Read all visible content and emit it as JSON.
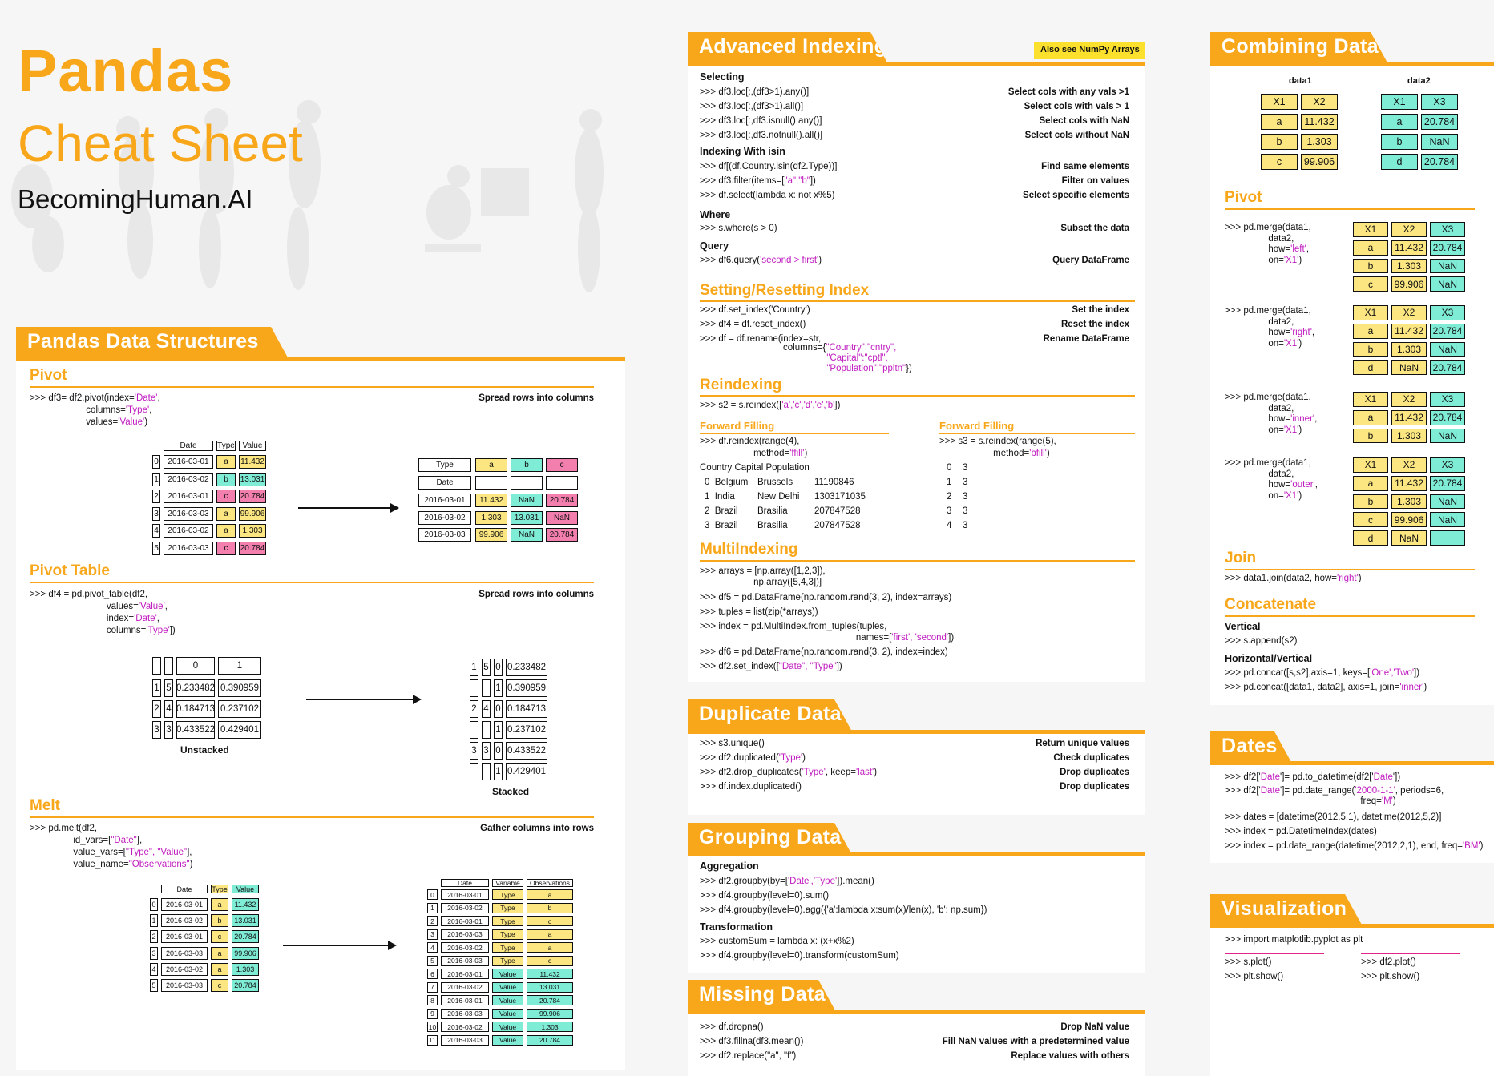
{
  "header": {
    "title": "Pandas",
    "subtitle": "Cheat Sheet",
    "brand": "BecomingHuman.AI"
  },
  "colors": {
    "accent": "#f9a71a",
    "yellow": "#fbe681",
    "teal": "#7fecd6",
    "pink": "#f27fad",
    "magenta": "#c01bbf"
  },
  "structures": {
    "title": "Pandas Data Structures",
    "pivot": {
      "title": "Pivot",
      "desc": "Spread rows into columns",
      "l1": ">>> df3= df2.pivot(index=",
      "l1m": "'Date'",
      "l1e": ",",
      "l2": "columns=",
      "l2m": "'Type'",
      "l2e": ",",
      "l3": "values=",
      "l3m": "'Value'",
      "l3e": ")"
    },
    "pivot_table": {
      "title": "Pivot Table",
      "desc": "Spread rows into columns",
      "l1": ">>> df4 = pd.pivot_table(df2,",
      "l2": "values=",
      "l2m": "'Value'",
      "l2e": ",",
      "l3": "index=",
      "l3m": "'Date'",
      "l3e": ",",
      "l4": "columns=",
      "l4m": "'Type'",
      "l4e": "])",
      "unstacked": "Unstacked",
      "stacked": "Stacked"
    },
    "melt": {
      "title": "Melt",
      "desc": "Gather columns into rows",
      "l1": ">>> pd.melt(df2,",
      "l2": "id_vars=[",
      "l2m": "\"Date\"",
      "l2e": "],",
      "l3": "value_vars=[",
      "l3m": "\"Type\", \"Value\"",
      "l3e": "],",
      "l4": "value_name=",
      "l4m": "\"Observations\"",
      "l4e": ")"
    }
  },
  "pivot_src": {
    "headers": [
      "Date",
      "Type",
      "Value"
    ],
    "rows": [
      [
        "0",
        "2016-03-01",
        "a",
        "11.432"
      ],
      [
        "1",
        "2016-03-02",
        "b",
        "13.031"
      ],
      [
        "2",
        "2016-03-01",
        "c",
        "20.784"
      ],
      [
        "3",
        "2016-03-03",
        "a",
        "99.906"
      ],
      [
        "4",
        "2016-03-02",
        "a",
        "1.303"
      ],
      [
        "5",
        "2016-03-03",
        "c",
        "20.784"
      ]
    ]
  },
  "pivot_dst": {
    "type": "Type",
    "date": "Date",
    "a": "a",
    "b": "b",
    "c": "c",
    "rows": [
      [
        "2016-03-01",
        "11.432",
        "NaN",
        "20.784"
      ],
      [
        "2016-03-02",
        "1.303",
        "13.031",
        "NaN"
      ],
      [
        "2016-03-03",
        "99.906",
        "NaN",
        "20.784"
      ]
    ]
  },
  "pt_src": {
    "h0": "0",
    "h1": "1",
    "rows": [
      [
        "1",
        "5",
        "0.233482",
        "0.390959"
      ],
      [
        "2",
        "4",
        "0.184713",
        "0.237102"
      ],
      [
        "3",
        "3",
        "0.433522",
        "0.429401"
      ]
    ]
  },
  "pt_dst": {
    "rows": [
      [
        "1",
        "5",
        "0",
        "0.233482"
      ],
      [
        "",
        "",
        "1",
        "0.390959"
      ],
      [
        "2",
        "4",
        "0",
        "0.184713"
      ],
      [
        "",
        "",
        "1",
        "0.237102"
      ],
      [
        "3",
        "3",
        "0",
        "0.433522"
      ],
      [
        "",
        "",
        "1",
        "0.429401"
      ]
    ]
  },
  "melt_src": {
    "headers": [
      "Date",
      "Type",
      "Value"
    ],
    "rows": [
      [
        "0",
        "2016-03-01",
        "a",
        "11.432"
      ],
      [
        "1",
        "2016-03-02",
        "b",
        "13.031"
      ],
      [
        "2",
        "2016-03-01",
        "c",
        "20.784"
      ],
      [
        "3",
        "2016-03-03",
        "a",
        "99.906"
      ],
      [
        "4",
        "2016-03-02",
        "a",
        "1.303"
      ],
      [
        "5",
        "2016-03-03",
        "c",
        "20.784"
      ]
    ]
  },
  "melt_dst": {
    "headers": [
      "Date",
      "Variable",
      "Observations"
    ],
    "rows": [
      [
        "0",
        "2016-03-01",
        "Type",
        "a"
      ],
      [
        "1",
        "2016-03-02",
        "Type",
        "b"
      ],
      [
        "2",
        "2016-03-01",
        "Type",
        "c"
      ],
      [
        "3",
        "2016-03-03",
        "Type",
        "a"
      ],
      [
        "4",
        "2016-03-02",
        "Type",
        "a"
      ],
      [
        "5",
        "2016-03-03",
        "Type",
        "c"
      ],
      [
        "6",
        "2016-03-01",
        "Value",
        "11.432"
      ],
      [
        "7",
        "2016-03-02",
        "Value",
        "13.031"
      ],
      [
        "8",
        "2016-03-01",
        "Value",
        "20.784"
      ],
      [
        "9",
        "2016-03-03",
        "Value",
        "99.906"
      ],
      [
        "10",
        "2016-03-02",
        "Value",
        "1.303"
      ],
      [
        "11",
        "2016-03-03",
        "Value",
        "20.784"
      ]
    ]
  },
  "adv": {
    "title": "Advanced Indexing",
    "badge": "Also see NumPy Arrays",
    "selecting": "Selecting",
    "sel": [
      [
        ">>> df3.loc[:,(df3>1).any()]",
        "Select cols with any vals >1"
      ],
      [
        ">>> df3.loc[:,(df3>1).all()]",
        "Select cols with vals > 1"
      ],
      [
        ">>> df3.loc[:,df3.isnull().any()]",
        "Select cols with NaN"
      ],
      [
        ">>> df3.loc[:,df3.notnull().all()]",
        "Select cols without NaN"
      ]
    ],
    "isin": "Indexing With isin",
    "isin1": ">>> df[(df.Country.isin(df2.Type))]",
    "isin1d": "Find same elements",
    "isin2a": ">>> df3.filter(items=",
    "isin2m": "\"a\",\"b\"",
    "isin2e": "])",
    "isin2d": "Filter on values",
    "isin3": ">>> df.select(lambda x: not x%5)",
    "isin3d": "Select specific elements",
    "where": "Where",
    "where1": ">>> s.where(s > 0)",
    "where1d": "Subset the data",
    "query": "Query",
    "query1a": ">>> df6.query(",
    "query1m": "'second > first'",
    "query1e": ")",
    "query1d": "Query DataFrame",
    "setreset": "Setting/Resetting Index",
    "sr": [
      [
        ">>> df.set_index('Country')",
        "Set the index"
      ],
      [
        ">>> df4 = df.reset_index()",
        "Reset the index"
      ],
      [
        ">>> df = df.rename(index=str,",
        "Rename DataFrame"
      ]
    ],
    "sr_c1a": "columns={",
    "sr_c1m": "\"Country\":\"cntry\",",
    "sr_c2m": "\"Capital\":\"cptl\",",
    "sr_c3m": "\"Population\":\"ppltn\"",
    "sr_c3e": "})",
    "reindex": "Reindexing",
    "ri1a": ">>> s2 = s.reindex([",
    "ri1m": "'a','c','d','e','b'",
    "ri1e": "])",
    "ff": "Forward Filling",
    "ff1": ">>> df.reindex(range(4),",
    "ff2a": "method=",
    "ff2m": "'ffill'",
    "ff2e": ")",
    "ff_table": [
      [
        "Country Capital Population"
      ],
      [
        "0  Belgium",
        "Brussels",
        "11190846"
      ],
      [
        "1  India",
        "New Delhi",
        "1303171035"
      ],
      [
        "2  Brazil",
        "Brasilia",
        "207847528"
      ],
      [
        "3  Brazil",
        "Brasilia",
        "207847528"
      ]
    ],
    "bf": "Forward Filling",
    "bf1": ">>> s3 = s.reindex(range(5),",
    "bf2a": "method=",
    "bf2m": "'bfill'",
    "bf2e": ")",
    "bf_table": [
      [
        "0",
        "3"
      ],
      [
        "1",
        "3"
      ],
      [
        "2",
        "3"
      ],
      [
        "3",
        "3"
      ],
      [
        "4",
        "3"
      ]
    ],
    "multi": "MultiIndexing",
    "mi1": ">>> arrays = [np.array([1,2,3]),",
    "mi2": "np.array([5,4,3])]",
    "mi3": ">>> df5 = pd.DataFrame(np.random.rand(3, 2), index=arrays)",
    "mi4": ">>> tuples = list(zip(*arrays))",
    "mi5": ">>> index = pd.MultiIndex.from_tuples(tuples,",
    "mi6a": "names=[",
    "mi6m": "'first', 'second'",
    "mi6e": "])",
    "mi7": ">>> df6 = pd.DataFrame(np.random.rand(3, 2), index=index)",
    "mi8a": ">>> df2.set_index([",
    "mi8m": "\"Date\", \"Type\"",
    "mi8e": "])"
  },
  "dup": {
    "title": "Duplicate Data",
    "rows": [
      [
        ">>> s3.unique()",
        "",
        "",
        "Return unique values"
      ],
      [
        ">>> df2.duplicated(",
        "'Type'",
        ")",
        "Check duplicates"
      ],
      [
        ">>> df2.drop_duplicates(",
        "'Type'",
        ", keep='last')",
        "Drop duplicates"
      ],
      [
        ">>> df.index.duplicated()",
        "",
        "",
        "Drop duplicates"
      ]
    ],
    "keep_m": "'last'"
  },
  "group": {
    "title": "Grouping Data",
    "agg": "Aggregation",
    "g1a": ">>> df2.groupby(by=[",
    "g1m": "'Date','Type'",
    "g1e": "]).mean()",
    "g2": ">>> df4.groupby(level=0).sum()",
    "g3": ">>> df4.groupby(level=0).agg({'a':lambda x:sum(x)/len(x), 'b': np.sum})",
    "trans": "Transformation",
    "t1": ">>> customSum = lambda x: (x+x%2)",
    "t2": ">>> df4.groupby(level=0).transform(customSum)"
  },
  "missing": {
    "title": "Missing Data",
    "rows": [
      [
        ">>> df.dropna()",
        "Drop NaN value"
      ],
      [
        ">>> df3.fillna(df3.mean())",
        "Fill NaN values with a predetermined value"
      ],
      [
        ">>> df2.replace(\"a\", \"f\")",
        "Replace values with others"
      ]
    ]
  },
  "combine": {
    "title": "Combining Data",
    "data1": "data1",
    "data2": "data2",
    "d1": [
      [
        "X1",
        "X2"
      ],
      [
        "a",
        "11.432"
      ],
      [
        "b",
        "1.303"
      ],
      [
        "c",
        "99.906"
      ]
    ],
    "d2": [
      [
        "X1",
        "X3"
      ],
      [
        "a",
        "20.784"
      ],
      [
        "b",
        "NaN"
      ],
      [
        "d",
        "20.784"
      ]
    ],
    "pivot": "Pivot",
    "merges": [
      {
        "how": "'left'",
        "rows": [
          [
            "X1",
            "X2",
            "X3"
          ],
          [
            "a",
            "11.432",
            "20.784"
          ],
          [
            "b",
            "1.303",
            "NaN"
          ],
          [
            "c",
            "99.906",
            "NaN"
          ]
        ]
      },
      {
        "how": "'right'",
        "rows": [
          [
            "X1",
            "X2",
            "X3"
          ],
          [
            "a",
            "11.432",
            "20.784"
          ],
          [
            "b",
            "1.303",
            "NaN"
          ],
          [
            "d",
            "NaN",
            "20.784"
          ]
        ]
      },
      {
        "how": "'inner'",
        "rows": [
          [
            "X1",
            "X2",
            "X3"
          ],
          [
            "a",
            "11.432",
            "20.784"
          ],
          [
            "b",
            "1.303",
            "NaN"
          ]
        ]
      },
      {
        "how": "'outer'",
        "rows": [
          [
            "X1",
            "X2",
            "X3"
          ],
          [
            "a",
            "11.432",
            "20.784"
          ],
          [
            "b",
            "1.303",
            "NaN"
          ],
          [
            "c",
            "99.906",
            "NaN"
          ],
          [
            "d",
            "NaN",
            ""
          ]
        ]
      }
    ],
    "m1": ">>> pd.merge(data1,",
    "m2": "data2,",
    "m3": "how=",
    "m4": "on=",
    "m4m": "'X1'",
    "m4e": ")",
    "join": "Join",
    "j1a": ">>> data1.join(data2, how=",
    "j1m": "'right'",
    "j1e": ")",
    "concat": "Concatenate",
    "vertical": "Vertical",
    "v1": ">>> s.append(s2)",
    "hv": "Horizontal/Vertical",
    "hv1a": ">>> pd.concat([s,s2],axis=1, keys=[",
    "hv1m": "'One','Two'",
    "hv1e": "])",
    "hv2a": ">>> pd.concat([data1, data2], axis=1, join=",
    "hv2m": "'inner'",
    "hv2e": ")"
  },
  "dates": {
    "title": "Dates",
    "d1a": ">>> df2['",
    "d1m": "Date",
    "d1b": "']= pd.to_datetime(df2['",
    "d1e": "'])",
    "d2a": ">>> df2['",
    "d2b": "']= pd.date_range(",
    "d2m": "'2000-1-1'",
    "d2c": ", periods=6,",
    "d3a": "freq=",
    "d3m": "'M'",
    "d3e": ")",
    "d4": ">>> dates = [datetime(2012,5,1), datetime(2012,5,2)]",
    "d5": ">>> index = pd.DatetimeIndex(dates)",
    "d6a": ">>> index = pd.date_range(datetime(2012,2,1), end, freq=",
    "d6m": "'BM'",
    "d6e": ")"
  },
  "viz": {
    "title": "Visualization",
    "v1": ">>> import matplotlib.pyplot as plt",
    "v2": ">>> s.plot()",
    "v3": ">>> plt.show()",
    "v4": ">>> df2.plot()",
    "v5": ">>> plt.show()"
  }
}
